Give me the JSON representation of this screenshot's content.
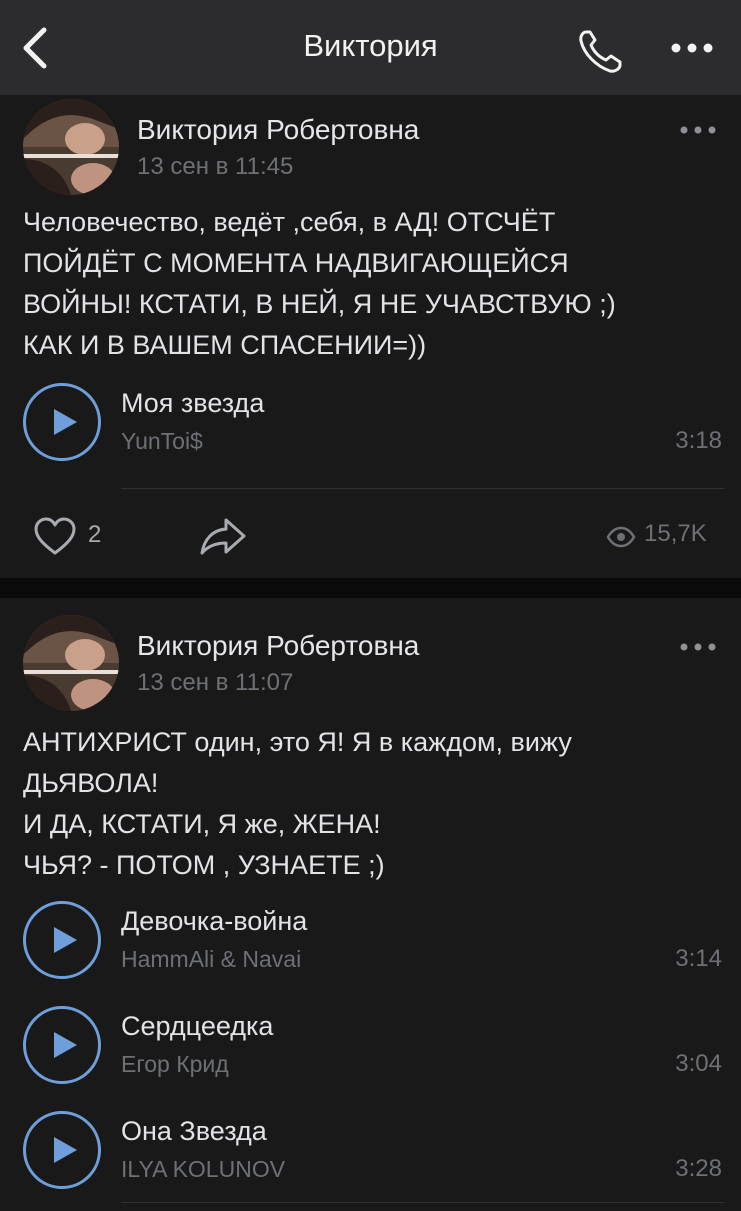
{
  "header": {
    "title": "Виктория",
    "back_icon": "chevron-left-icon",
    "call_icon": "phone-icon",
    "more_icon": "more-horizontal-icon"
  },
  "posts": [
    {
      "author": "Виктория Робертовна",
      "date": "13 сен в 11:45",
      "text": "Человечество, ведёт ,себя, в АД! ОТСЧЁТ\nПОЙДЁТ С МОМЕНТА НАДВИГАЮЩЕЙСЯ\nВОЙНЫ! КСТАТИ, В НЕЙ, Я НЕ УЧАВСТВУЮ ;)\nКАК И В ВАШЕМ СПАСЕНИИ=))",
      "tracks": [
        {
          "title": "Моя звезда",
          "artist": "YunToi$",
          "duration": "3:18"
        }
      ],
      "likes": "2",
      "views": "15,7K"
    },
    {
      "author": "Виктория Робертовна",
      "date": "13 сен в 11:07",
      "text": "АНТИХРИСТ один, это Я! Я в каждом, вижу\nДЬЯВОЛА!\nИ ДА, КСТАТИ, Я же, ЖЕНА!\nЧЬЯ? - ПОТОМ , УЗНАЕТЕ ;)",
      "tracks": [
        {
          "title": "Девочка-война",
          "artist": "HammAli & Navai",
          "duration": "3:14"
        },
        {
          "title": "Сердцеедка",
          "artist": "Егор Крид",
          "duration": "3:04"
        },
        {
          "title": "Она Звезда",
          "artist": "ILYA KOLUNOV",
          "duration": "3:28"
        }
      ]
    }
  ],
  "colors": {
    "accent": "#6f9fda",
    "background": "#0a0a0a",
    "card": "#19191a",
    "header": "#2c2c2e",
    "secondary_text": "#6d7075"
  }
}
